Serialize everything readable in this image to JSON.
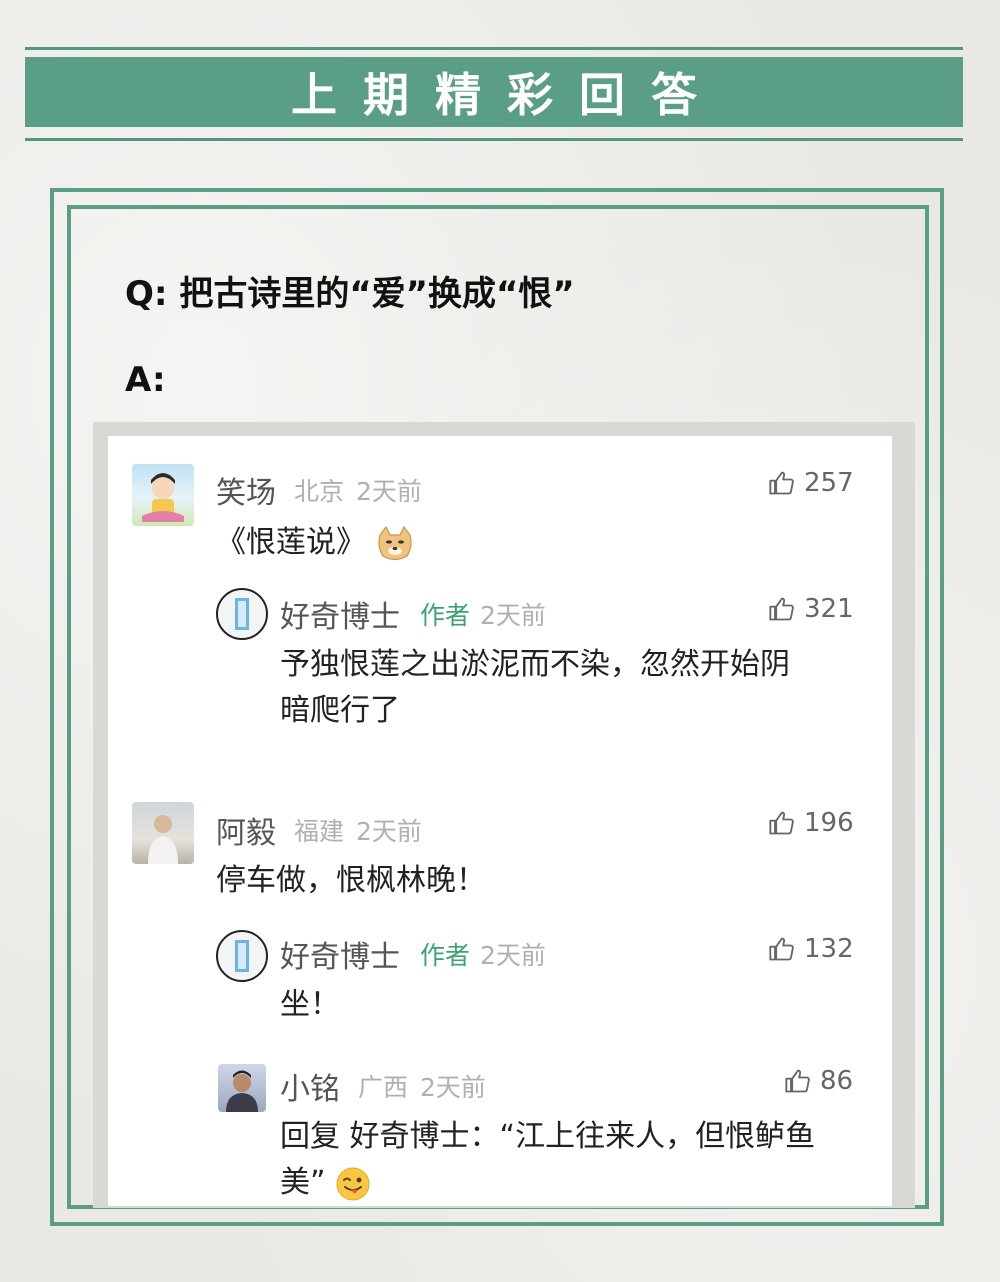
{
  "header": {
    "title": "上期精彩回答"
  },
  "question": "Q: 把古诗里的“爱”换成“恨”",
  "answer_label": "A:",
  "comments": [
    {
      "name": "笑场",
      "location": "北京",
      "time": "2天前",
      "likes": "257",
      "text": "《恨莲说》"
    },
    {
      "name": "好奇博士",
      "author_tag": "作者",
      "time": "2天前",
      "likes": "321",
      "text_line1": "予独恨莲之出淤泥而不染，忽然开始阴",
      "text_line2": "暗爬行了"
    },
    {
      "name": "阿毅",
      "location": "福建",
      "time": "2天前",
      "likes": "196",
      "text": "停车做，恨枫林晚！"
    },
    {
      "name": "好奇博士",
      "author_tag": "作者",
      "time": "2天前",
      "likes": "132",
      "text": "坐！"
    },
    {
      "name": "小铭",
      "location": "广西",
      "time": "2天前",
      "likes": "86",
      "text_line1": "回复 好奇博士：“江上往来人，但恨鲈鱼",
      "text_line2": "美”"
    }
  ],
  "colors": {
    "accent": "#5a9e85",
    "author_green": "#3aa36f"
  },
  "icons": [
    "thumbs-up-icon",
    "doge-emoji-icon",
    "wink-tongue-emoji-icon"
  ]
}
